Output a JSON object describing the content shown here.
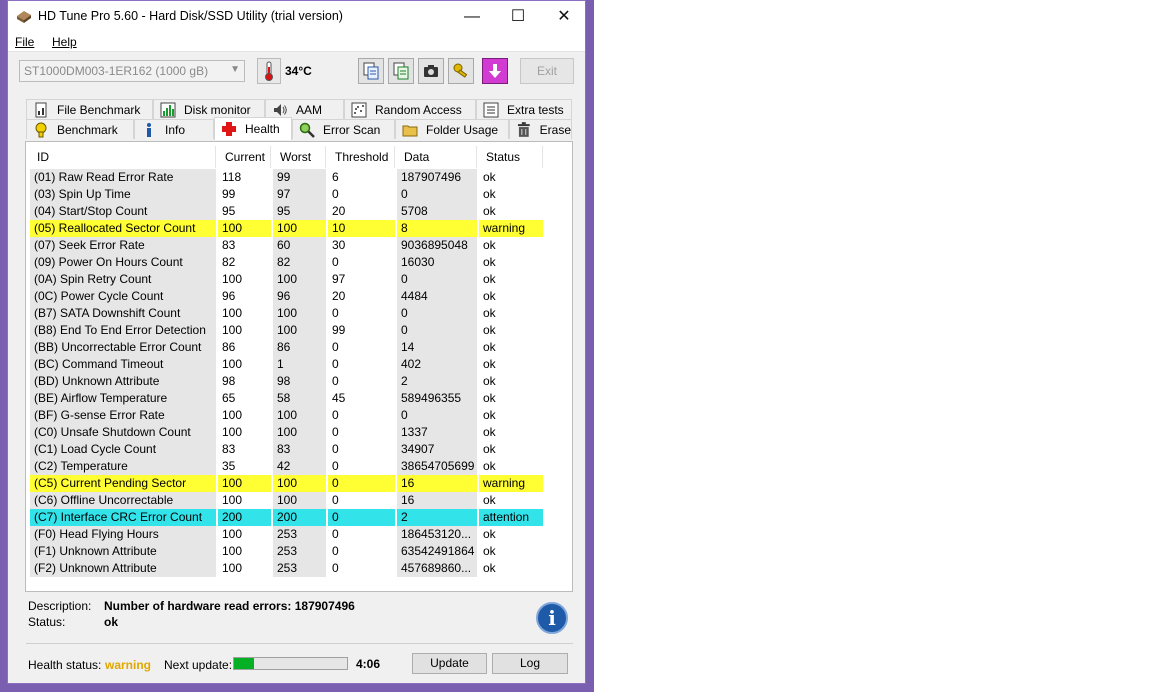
{
  "window": {
    "title": "HD Tune Pro 5.60 - Hard Disk/SSD Utility (trial version)",
    "min_glyph": "—",
    "max_glyph": "☐",
    "close_glyph": "✕"
  },
  "menu": {
    "file": "File",
    "help": "Help"
  },
  "toolbar": {
    "drive": "ST1000DM003-1ER162 (1000 gB)",
    "temperature": "34°C",
    "exit_label": "Exit",
    "icons": [
      "copy-text-icon",
      "copy-info-icon",
      "screenshot-camera-icon",
      "options-keys-icon",
      "save-download-icon"
    ]
  },
  "tabs": {
    "row1": [
      "File Benchmark",
      "Disk monitor",
      "AAM",
      "Random Access",
      "Extra tests"
    ],
    "row2": [
      "Benchmark",
      "Info",
      "Health",
      "Error Scan",
      "Folder Usage",
      "Erase"
    ]
  },
  "table": {
    "headers": [
      "ID",
      "Current",
      "Worst",
      "Threshold",
      "Data",
      "Status"
    ],
    "rows": [
      {
        "id": "(01) Raw Read Error Rate",
        "current": "118",
        "worst": "99",
        "threshold": "6",
        "data": "187907496",
        "status": "ok"
      },
      {
        "id": "(03) Spin Up Time",
        "current": "99",
        "worst": "97",
        "threshold": "0",
        "data": "0",
        "status": "ok"
      },
      {
        "id": "(04) Start/Stop Count",
        "current": "95",
        "worst": "95",
        "threshold": "20",
        "data": "5708",
        "status": "ok"
      },
      {
        "id": "(05) Reallocated Sector Count",
        "current": "100",
        "worst": "100",
        "threshold": "10",
        "data": "8",
        "status": "warning"
      },
      {
        "id": "(07) Seek Error Rate",
        "current": "83",
        "worst": "60",
        "threshold": "30",
        "data": "9036895048",
        "status": "ok"
      },
      {
        "id": "(09) Power On Hours Count",
        "current": "82",
        "worst": "82",
        "threshold": "0",
        "data": "16030",
        "status": "ok"
      },
      {
        "id": "(0A) Spin Retry Count",
        "current": "100",
        "worst": "100",
        "threshold": "97",
        "data": "0",
        "status": "ok"
      },
      {
        "id": "(0C) Power Cycle Count",
        "current": "96",
        "worst": "96",
        "threshold": "20",
        "data": "4484",
        "status": "ok"
      },
      {
        "id": "(B7) SATA Downshift Count",
        "current": "100",
        "worst": "100",
        "threshold": "0",
        "data": "0",
        "status": "ok"
      },
      {
        "id": "(B8) End To End Error Detection",
        "current": "100",
        "worst": "100",
        "threshold": "99",
        "data": "0",
        "status": "ok"
      },
      {
        "id": "(BB) Uncorrectable Error Count",
        "current": "86",
        "worst": "86",
        "threshold": "0",
        "data": "14",
        "status": "ok"
      },
      {
        "id": "(BC) Command Timeout",
        "current": "100",
        "worst": "1",
        "threshold": "0",
        "data": "402",
        "status": "ok"
      },
      {
        "id": "(BD) Unknown Attribute",
        "current": "98",
        "worst": "98",
        "threshold": "0",
        "data": "2",
        "status": "ok"
      },
      {
        "id": "(BE) Airflow Temperature",
        "current": "65",
        "worst": "58",
        "threshold": "45",
        "data": "589496355",
        "status": "ok"
      },
      {
        "id": "(BF) G-sense Error Rate",
        "current": "100",
        "worst": "100",
        "threshold": "0",
        "data": "0",
        "status": "ok"
      },
      {
        "id": "(C0) Unsafe Shutdown Count",
        "current": "100",
        "worst": "100",
        "threshold": "0",
        "data": "1337",
        "status": "ok"
      },
      {
        "id": "(C1) Load Cycle Count",
        "current": "83",
        "worst": "83",
        "threshold": "0",
        "data": "34907",
        "status": "ok"
      },
      {
        "id": "(C2) Temperature",
        "current": "35",
        "worst": "42",
        "threshold": "0",
        "data": "38654705699",
        "status": "ok"
      },
      {
        "id": "(C5) Current Pending Sector",
        "current": "100",
        "worst": "100",
        "threshold": "0",
        "data": "16",
        "status": "warning"
      },
      {
        "id": "(C6) Offline Uncorrectable",
        "current": "100",
        "worst": "100",
        "threshold": "0",
        "data": "16",
        "status": "ok"
      },
      {
        "id": "(C7) Interface CRC Error Count",
        "current": "200",
        "worst": "200",
        "threshold": "0",
        "data": "2",
        "status": "attention"
      },
      {
        "id": "(F0) Head Flying Hours",
        "current": "100",
        "worst": "253",
        "threshold": "0",
        "data": "186453120...",
        "status": "ok"
      },
      {
        "id": "(F1) Unknown Attribute",
        "current": "100",
        "worst": "253",
        "threshold": "0",
        "data": "63542491864",
        "status": "ok"
      },
      {
        "id": "(F2) Unknown Attribute",
        "current": "100",
        "worst": "253",
        "threshold": "0",
        "data": "457689860...",
        "status": "ok"
      }
    ]
  },
  "details": {
    "description_label": "Description:",
    "description_value": "Number of hardware read errors: 187907496",
    "status_label": "Status:",
    "status_value": "ok"
  },
  "footer": {
    "health_label": "Health status:",
    "health_value": "warning",
    "next_update_label": "Next update:",
    "progress_fraction": 0.18,
    "countdown": "4:06",
    "update_button": "Update",
    "log_button": "Log"
  },
  "colors": {
    "warning_row": "#ffff33",
    "attention_row": "#33e3ea",
    "health_warning_text": "#e0a800",
    "progress_fill": "#06b025",
    "desktop_border": "#7a5fb0"
  }
}
